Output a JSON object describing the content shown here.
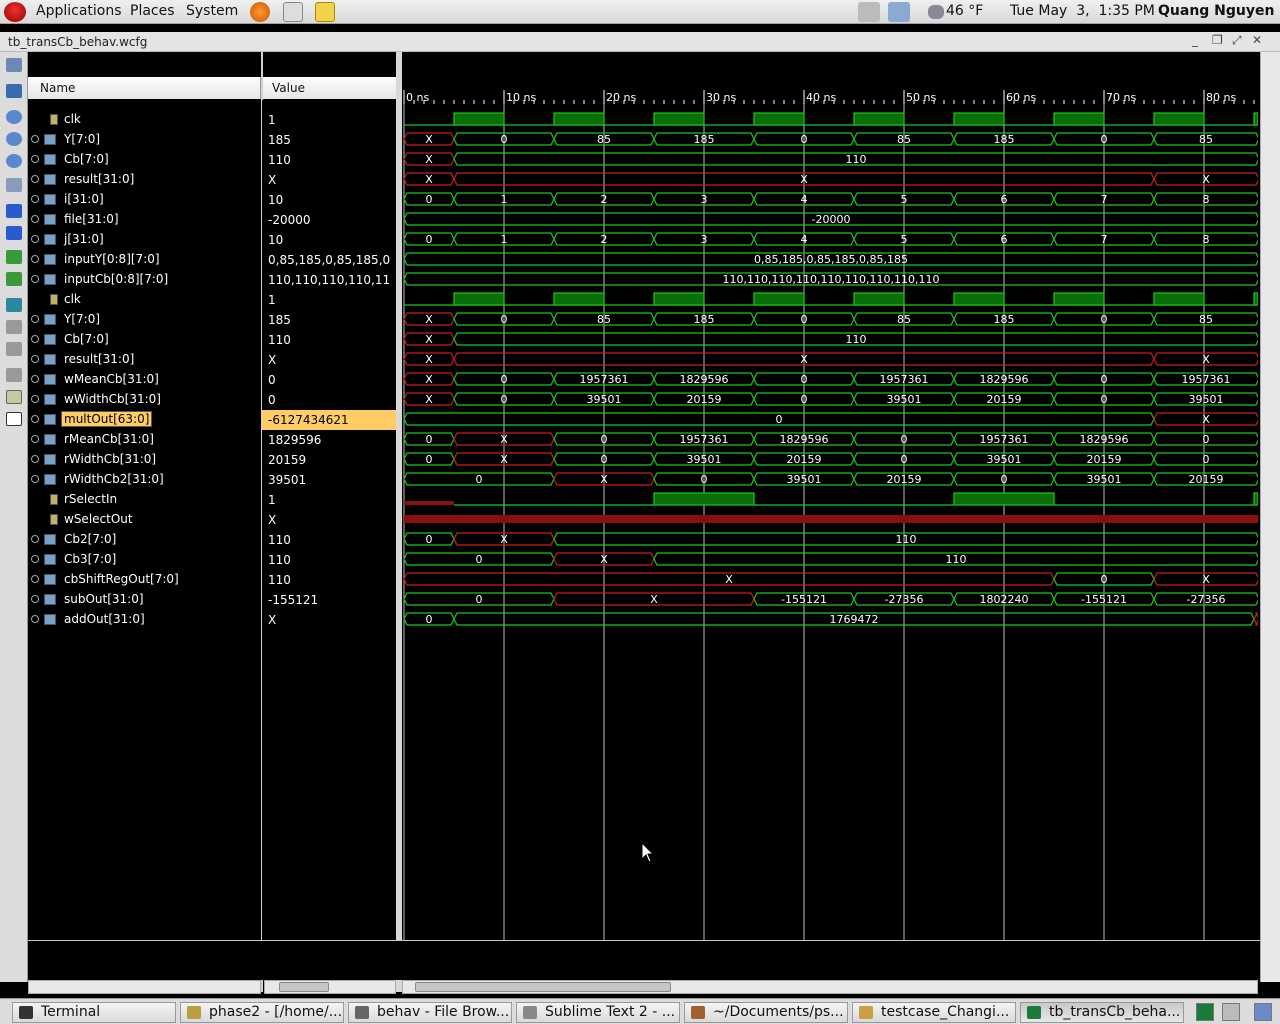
{
  "topbar": {
    "menus": [
      "Applications",
      "Places",
      "System"
    ],
    "weather": "46 °F",
    "datetime": "Tue May  3,  1:35 PM",
    "user": "Quang Nguyen",
    "launcher_icons": [
      "firefox-icon",
      "mail-icon",
      "notes-icon"
    ]
  },
  "window": {
    "title": "tb_transCb_behav.wcfg",
    "controls": [
      "_",
      "❐",
      "⤢",
      "✕"
    ]
  },
  "columns": {
    "name": "Name",
    "value": "Value"
  },
  "signals": [
    {
      "name": "clk",
      "value": "1",
      "bus": false
    },
    {
      "name": "Y[7:0]",
      "value": "185",
      "bus": true
    },
    {
      "name": "Cb[7:0]",
      "value": "110",
      "bus": true
    },
    {
      "name": "result[31:0]",
      "value": "X",
      "bus": true
    },
    {
      "name": "i[31:0]",
      "value": "10",
      "bus": true
    },
    {
      "name": "file[31:0]",
      "value": "-20000",
      "bus": true
    },
    {
      "name": "j[31:0]",
      "value": "10",
      "bus": true
    },
    {
      "name": "inputY[0:8][7:0]",
      "value": "0,85,185,0,85,185,0",
      "bus": true
    },
    {
      "name": "inputCb[0:8][7:0]",
      "value": "110,110,110,110,11",
      "bus": true
    },
    {
      "name": "clk",
      "value": "1",
      "bus": false
    },
    {
      "name": "Y[7:0]",
      "value": "185",
      "bus": true
    },
    {
      "name": "Cb[7:0]",
      "value": "110",
      "bus": true
    },
    {
      "name": "result[31:0]",
      "value": "X",
      "bus": true
    },
    {
      "name": "wMeanCb[31:0]",
      "value": "0",
      "bus": true
    },
    {
      "name": "wWidthCb[31:0]",
      "value": "0",
      "bus": true
    },
    {
      "name": "multOut[63:0]",
      "value": "-6127434621",
      "bus": true,
      "selected": true
    },
    {
      "name": "rMeanCb[31:0]",
      "value": "1829596",
      "bus": true
    },
    {
      "name": "rWidthCb[31:0]",
      "value": "20159",
      "bus": true
    },
    {
      "name": "rWidthCb2[31:0]",
      "value": "39501",
      "bus": true
    },
    {
      "name": "rSelectIn",
      "value": "1",
      "bus": false
    },
    {
      "name": "wSelectOut",
      "value": "X",
      "bus": false
    },
    {
      "name": "Cb2[7:0]",
      "value": "110",
      "bus": true
    },
    {
      "name": "Cb3[7:0]",
      "value": "110",
      "bus": true
    },
    {
      "name": "cbShiftRegOut[7:0]",
      "value": "110",
      "bus": true
    },
    {
      "name": "subOut[31:0]",
      "value": "-155121",
      "bus": true
    },
    {
      "name": "addOut[31:0]",
      "value": "X",
      "bus": true
    }
  ],
  "timeline": {
    "ticks": [
      "0 ns",
      "10 ns",
      "20 ns",
      "30 ns",
      "40 ns",
      "50 ns",
      "60 ns",
      "70 ns",
      "80 ns"
    ],
    "range_ns": [
      0,
      85.5
    ]
  },
  "waves": [
    {
      "type": "clock",
      "periods": [
        [
          5,
          10
        ],
        [
          15,
          20
        ],
        [
          25,
          30
        ],
        [
          35,
          40
        ],
        [
          45,
          50
        ],
        [
          55,
          60
        ],
        [
          65,
          70
        ],
        [
          75,
          80
        ],
        [
          85,
          85.5
        ]
      ]
    },
    {
      "type": "bus",
      "segs": [
        [
          0,
          5,
          "X",
          "red"
        ],
        [
          5,
          15,
          "0",
          "green"
        ],
        [
          15,
          25,
          "85",
          "green"
        ],
        [
          25,
          35,
          "185",
          "green"
        ],
        [
          35,
          45,
          "0",
          "green"
        ],
        [
          45,
          55,
          "85",
          "green"
        ],
        [
          55,
          65,
          "185",
          "green"
        ],
        [
          65,
          75,
          "0",
          "green"
        ],
        [
          75,
          85.5,
          "85",
          "green"
        ]
      ]
    },
    {
      "type": "bus",
      "segs": [
        [
          0,
          5,
          "X",
          "red"
        ],
        [
          5,
          85.5,
          "110",
          "green"
        ]
      ]
    },
    {
      "type": "bus",
      "segs": [
        [
          0,
          5,
          "X",
          "red"
        ],
        [
          5,
          75,
          "X",
          "red"
        ],
        [
          75,
          85.5,
          "X",
          "red"
        ]
      ]
    },
    {
      "type": "bus",
      "segs": [
        [
          0,
          5,
          "0",
          "green"
        ],
        [
          5,
          15,
          "1",
          "green"
        ],
        [
          15,
          25,
          "2",
          "green"
        ],
        [
          25,
          35,
          "3",
          "green"
        ],
        [
          35,
          45,
          "4",
          "green"
        ],
        [
          45,
          55,
          "5",
          "green"
        ],
        [
          55,
          65,
          "6",
          "green"
        ],
        [
          65,
          75,
          "7",
          "green"
        ],
        [
          75,
          85.5,
          "8",
          "green"
        ]
      ]
    },
    {
      "type": "bus",
      "segs": [
        [
          0,
          85.5,
          "-20000",
          "green"
        ]
      ]
    },
    {
      "type": "bus",
      "segs": [
        [
          0,
          5,
          "0",
          "green"
        ],
        [
          5,
          15,
          "1",
          "green"
        ],
        [
          15,
          25,
          "2",
          "green"
        ],
        [
          25,
          35,
          "3",
          "green"
        ],
        [
          35,
          45,
          "4",
          "green"
        ],
        [
          45,
          55,
          "5",
          "green"
        ],
        [
          55,
          65,
          "6",
          "green"
        ],
        [
          65,
          75,
          "7",
          "green"
        ],
        [
          75,
          85.5,
          "8",
          "green"
        ]
      ]
    },
    {
      "type": "bus",
      "segs": [
        [
          0,
          85.5,
          "0,85,185,0,85,185,0,85,185",
          "green"
        ]
      ]
    },
    {
      "type": "bus",
      "segs": [
        [
          0,
          85.5,
          "110,110,110,110,110,110,110,110,110",
          "green"
        ]
      ]
    },
    {
      "type": "clock",
      "periods": [
        [
          5,
          10
        ],
        [
          15,
          20
        ],
        [
          25,
          30
        ],
        [
          35,
          40
        ],
        [
          45,
          50
        ],
        [
          55,
          60
        ],
        [
          65,
          70
        ],
        [
          75,
          80
        ],
        [
          85,
          85.5
        ]
      ]
    },
    {
      "type": "bus",
      "segs": [
        [
          0,
          5,
          "X",
          "red"
        ],
        [
          5,
          15,
          "0",
          "green"
        ],
        [
          15,
          25,
          "85",
          "green"
        ],
        [
          25,
          35,
          "185",
          "green"
        ],
        [
          35,
          45,
          "0",
          "green"
        ],
        [
          45,
          55,
          "85",
          "green"
        ],
        [
          55,
          65,
          "185",
          "green"
        ],
        [
          65,
          75,
          "0",
          "green"
        ],
        [
          75,
          85.5,
          "85",
          "green"
        ]
      ]
    },
    {
      "type": "bus",
      "segs": [
        [
          0,
          5,
          "X",
          "red"
        ],
        [
          5,
          85.5,
          "110",
          "green"
        ]
      ]
    },
    {
      "type": "bus",
      "segs": [
        [
          0,
          5,
          "X",
          "red"
        ],
        [
          5,
          75,
          "X",
          "red"
        ],
        [
          75,
          85.5,
          "X",
          "red"
        ]
      ]
    },
    {
      "type": "bus",
      "segs": [
        [
          0,
          5,
          "X",
          "red"
        ],
        [
          5,
          15,
          "0",
          "green"
        ],
        [
          15,
          25,
          "1957361",
          "green"
        ],
        [
          25,
          35,
          "1829596",
          "green"
        ],
        [
          35,
          45,
          "0",
          "green"
        ],
        [
          45,
          55,
          "1957361",
          "green"
        ],
        [
          55,
          65,
          "1829596",
          "green"
        ],
        [
          65,
          75,
          "0",
          "green"
        ],
        [
          75,
          85.5,
          "1957361",
          "green"
        ]
      ]
    },
    {
      "type": "bus",
      "segs": [
        [
          0,
          5,
          "X",
          "red"
        ],
        [
          5,
          15,
          "0",
          "green"
        ],
        [
          15,
          25,
          "39501",
          "green"
        ],
        [
          25,
          35,
          "20159",
          "green"
        ],
        [
          35,
          45,
          "0",
          "green"
        ],
        [
          45,
          55,
          "39501",
          "green"
        ],
        [
          55,
          65,
          "20159",
          "green"
        ],
        [
          65,
          75,
          "0",
          "green"
        ],
        [
          75,
          85.5,
          "39501",
          "green"
        ]
      ]
    },
    {
      "type": "bus",
      "segs": [
        [
          0,
          75,
          "0",
          "green"
        ],
        [
          75,
          85.5,
          "X",
          "red"
        ]
      ]
    },
    {
      "type": "bus",
      "segs": [
        [
          0,
          5,
          "0",
          "green"
        ],
        [
          5,
          15,
          "X",
          "red"
        ],
        [
          15,
          25,
          "0",
          "green"
        ],
        [
          25,
          35,
          "1957361",
          "green"
        ],
        [
          35,
          45,
          "1829596",
          "green"
        ],
        [
          45,
          55,
          "0",
          "green"
        ],
        [
          55,
          65,
          "1957361",
          "green"
        ],
        [
          65,
          75,
          "1829596",
          "green"
        ],
        [
          75,
          85.5,
          "0",
          "green"
        ]
      ]
    },
    {
      "type": "bus",
      "segs": [
        [
          0,
          5,
          "0",
          "green"
        ],
        [
          5,
          15,
          "X",
          "red"
        ],
        [
          15,
          25,
          "0",
          "green"
        ],
        [
          25,
          35,
          "39501",
          "green"
        ],
        [
          35,
          45,
          "20159",
          "green"
        ],
        [
          45,
          55,
          "0",
          "green"
        ],
        [
          55,
          65,
          "39501",
          "green"
        ],
        [
          65,
          75,
          "20159",
          "green"
        ],
        [
          75,
          85.5,
          "0",
          "green"
        ]
      ]
    },
    {
      "type": "bus",
      "segs": [
        [
          0,
          15,
          "0",
          "green"
        ],
        [
          15,
          25,
          "X",
          "red"
        ],
        [
          25,
          35,
          "0",
          "green"
        ],
        [
          35,
          45,
          "39501",
          "green"
        ],
        [
          45,
          55,
          "20159",
          "green"
        ],
        [
          55,
          65,
          "0",
          "green"
        ],
        [
          65,
          75,
          "39501",
          "green"
        ],
        [
          75,
          85.5,
          "20159",
          "green"
        ]
      ]
    },
    {
      "type": "bit",
      "segs": [
        [
          0,
          5,
          "0",
          "red"
        ],
        [
          5,
          25,
          "0",
          "green"
        ],
        [
          25,
          35,
          "1",
          "green"
        ],
        [
          35,
          55,
          "0",
          "green"
        ],
        [
          55,
          65,
          "1",
          "green"
        ],
        [
          65,
          85,
          "0",
          "green"
        ],
        [
          85,
          85.5,
          "1",
          "green"
        ]
      ]
    },
    {
      "type": "xbar"
    },
    {
      "type": "bus",
      "segs": [
        [
          0,
          5,
          "0",
          "green"
        ],
        [
          5,
          15,
          "X",
          "red"
        ],
        [
          15,
          85.5,
          "110",
          "green"
        ]
      ]
    },
    {
      "type": "bus",
      "segs": [
        [
          0,
          15,
          "0",
          "green"
        ],
        [
          15,
          25,
          "X",
          "red"
        ],
        [
          25,
          85.5,
          "110",
          "green"
        ]
      ]
    },
    {
      "type": "bus",
      "segs": [
        [
          0,
          65,
          "X",
          "red"
        ],
        [
          65,
          75,
          "0",
          "green"
        ],
        [
          75,
          85.5,
          "X",
          "red"
        ]
      ]
    },
    {
      "type": "bus",
      "segs": [
        [
          0,
          15,
          "0",
          "green"
        ],
        [
          15,
          35,
          "X",
          "red"
        ],
        [
          35,
          45,
          "-155121",
          "green"
        ],
        [
          45,
          55,
          "-27356",
          "green"
        ],
        [
          55,
          65,
          "1802240",
          "green"
        ],
        [
          65,
          75,
          "-155121",
          "green"
        ],
        [
          75,
          85.5,
          "-27356",
          "green"
        ]
      ]
    },
    {
      "type": "bus",
      "segs": [
        [
          0,
          5,
          "0",
          "green"
        ],
        [
          5,
          85,
          "1769472",
          "green"
        ],
        [
          85,
          85.5,
          "",
          "red"
        ]
      ]
    }
  ],
  "taskbar": [
    {
      "label": "Terminal"
    },
    {
      "label": "phase2 - [/home/..."
    },
    {
      "label": "behav - File Brow..."
    },
    {
      "label": "Sublime Text 2 - ..."
    },
    {
      "label": "~/Documents/ps..."
    },
    {
      "label": "testcase_Changi..."
    },
    {
      "label": "tb_transCb_beha...",
      "active": true
    }
  ],
  "colors": {
    "wave_green": "#19c819",
    "wave_red": "#c81e1e",
    "selected_bg": "#ffcc66",
    "clock_fill": "#0a6e0a"
  }
}
